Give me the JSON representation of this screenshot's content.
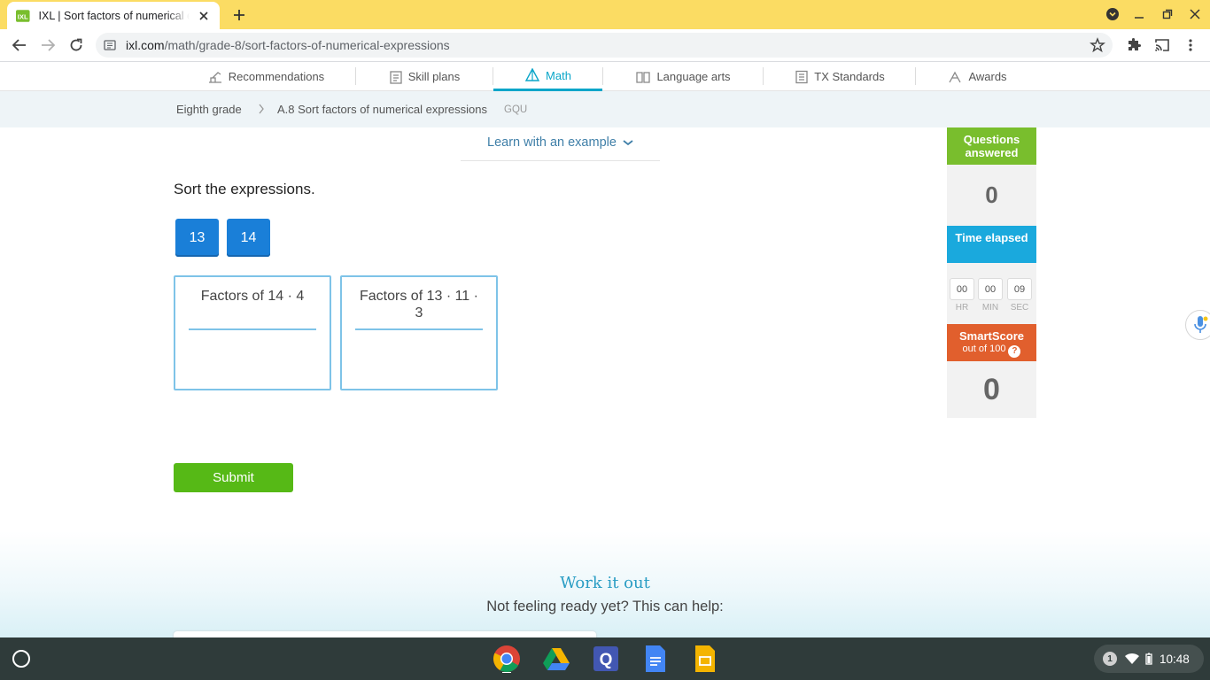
{
  "browser": {
    "tab_title": "IXL | Sort factors of numerical expressions",
    "url_host": "ixl.com",
    "url_path": "/math/grade-8/sort-factors-of-numerical-expressions",
    "theme_color": "#fbdc63"
  },
  "nav": {
    "tabs": [
      {
        "label": "Recommendations",
        "icon": "recommendations-icon"
      },
      {
        "label": "Skill plans",
        "icon": "skill-plans-icon"
      },
      {
        "label": "Math",
        "icon": "math-icon",
        "active": true
      },
      {
        "label": "Language arts",
        "icon": "book-icon"
      },
      {
        "label": "TX Standards",
        "icon": "standards-icon"
      },
      {
        "label": "Awards",
        "icon": "awards-icon"
      }
    ],
    "active_color": "#0aa6c9"
  },
  "breadcrumb": {
    "grade": "Eighth grade",
    "skill": "A.8 Sort factors of numerical expressions",
    "code": "GQU"
  },
  "learn_link": "Learn with an example",
  "question": {
    "prompt": "Sort the expressions.",
    "tiles": [
      "13",
      "14"
    ],
    "bins": [
      {
        "title": "Factors of 14 · 4"
      },
      {
        "title": "Factors of 13 · 11 · 3"
      }
    ],
    "submit_label": "Submit"
  },
  "sidebar": {
    "questions_label": "Questions answered",
    "questions_value": "0",
    "time_label": "Time elapsed",
    "time": {
      "hr": "00",
      "min": "00",
      "sec": "09"
    },
    "time_units": {
      "hr": "HR",
      "min": "MIN",
      "sec": "SEC"
    },
    "smartscore_label": "SmartScore",
    "smartscore_sub": "out of 100",
    "smartscore_help": "?",
    "smartscore_value": "0",
    "colors": {
      "questions": "#79be2d",
      "time": "#1aa9dd",
      "smartscore": "#e15f2d"
    }
  },
  "footer": {
    "heading": "Work it out",
    "subtext": "Not feeling ready yet? This can help:"
  },
  "shelf": {
    "apps": [
      "chrome-icon",
      "drive-icon",
      "quizlet-icon",
      "docs-icon",
      "slides-icon"
    ],
    "notification_count": "1",
    "clock": "10:48"
  }
}
